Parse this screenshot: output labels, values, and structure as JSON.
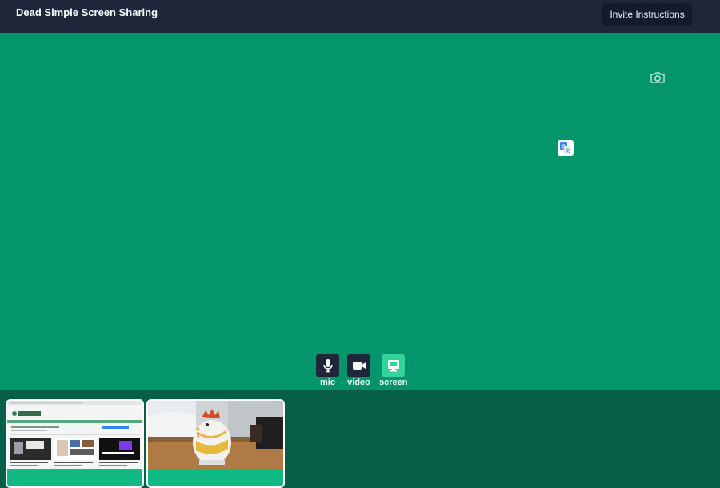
{
  "header": {
    "title": "Dead Simple Screen Sharing",
    "invite_label": "Invite Instructions"
  },
  "stage": {
    "camera_icon": "camera-icon",
    "translate_icon": "google-translate-icon"
  },
  "controls": [
    {
      "id": "mic",
      "label": "mic",
      "icon": "mic-icon",
      "active": false
    },
    {
      "id": "video",
      "label": "video",
      "icon": "video-camera-icon",
      "active": false
    },
    {
      "id": "screen",
      "label": "screen",
      "icon": "screen-share-icon",
      "active": true
    }
  ],
  "thumbnails": [
    {
      "id": "screen-share-thumb",
      "content": "shared browser screen"
    },
    {
      "id": "camera-thumb",
      "content": "webcam view of chicken kitchen timer"
    }
  ],
  "colors": {
    "header_bg": "#1e2639",
    "stage_bg": "#04956a",
    "thumb_bar_bg": "#065f46",
    "button_bg": "#1e2639",
    "active_button_bg": "#34d399"
  }
}
